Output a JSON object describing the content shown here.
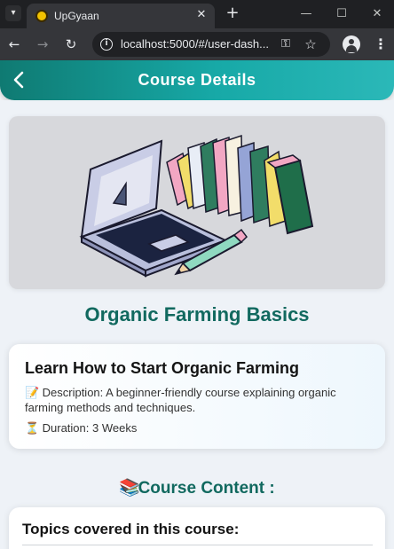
{
  "browser": {
    "tab_title": "UpGyaan",
    "tab_close": "✕",
    "new_tab": "+",
    "window_minimize": "—",
    "window_maximize": "☐",
    "window_close": "✕",
    "url": "localhost:5000/#/user-dash...",
    "icons": [
      "tab-dropdown-icon",
      "favicon-icon",
      "back-icon",
      "forward-icon",
      "reload-icon",
      "info-icon",
      "password-key-icon",
      "star-icon",
      "profile-icon",
      "menu-icon"
    ]
  },
  "header": {
    "title": "Course Details",
    "back_icon": "chevron-left-icon",
    "colors": {
      "gradient_start": "#0f7a72",
      "gradient_end": "#2bb8b8"
    }
  },
  "course": {
    "title": "Organic Farming Basics",
    "card": {
      "heading": "Learn How to Start Organic Farming",
      "description_emoji": "📝",
      "description": "Description: A beginner-friendly course explaining organic farming methods and techniques.",
      "duration_emoji": "⏳",
      "duration": "Duration: 3 Weeks"
    }
  },
  "content_section": {
    "emoji": "📚",
    "title": "Course Content :",
    "topics_heading": "Topics covered in this course:"
  },
  "colors": {
    "accent": "#11695f"
  }
}
